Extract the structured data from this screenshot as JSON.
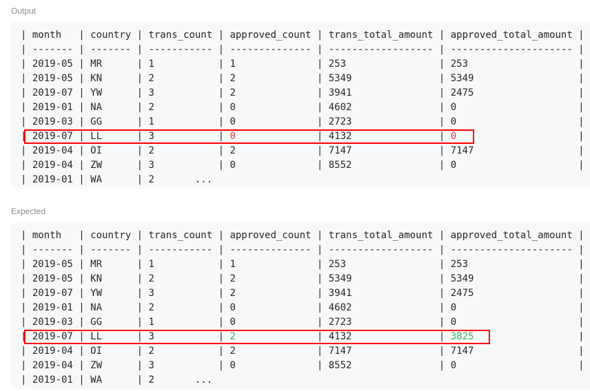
{
  "output": {
    "label": "Output",
    "header": [
      "month",
      "country",
      "trans_count",
      "approved_count",
      "trans_total_amount",
      "approved_total_amount"
    ],
    "separator": [
      "-------",
      "-------",
      "-----------",
      "--------------",
      "------------------",
      "---------------------"
    ],
    "rows": [
      [
        "2019-05",
        "MR",
        "1",
        "1",
        "253",
        "253"
      ],
      [
        "2019-05",
        "KN",
        "2",
        "2",
        "5349",
        "5349"
      ],
      [
        "2019-07",
        "YW",
        "3",
        "2",
        "3941",
        "2475"
      ],
      [
        "2019-01",
        "NA",
        "2",
        "0",
        "4602",
        "0"
      ],
      [
        "2019-03",
        "GG",
        "1",
        "0",
        "2723",
        "0"
      ],
      [
        "2019-07",
        "LL",
        "3",
        "0",
        "4132",
        "0"
      ],
      [
        "2019-04",
        "OI",
        "2",
        "2",
        "7147",
        "7147"
      ],
      [
        "2019-04",
        "ZW",
        "3",
        "0",
        "8552",
        "0"
      ]
    ],
    "last_row": [
      "2019-01",
      "WA",
      "2"
    ],
    "ellipsis": "...",
    "highlighted_row": 5,
    "highlight_color": "#ff0000",
    "diff_color": "#e04343"
  },
  "expected": {
    "label": "Expected",
    "header": [
      "month",
      "country",
      "trans_count",
      "approved_count",
      "trans_total_amount",
      "approved_total_amount"
    ],
    "separator": [
      "-------",
      "-------",
      "-----------",
      "--------------",
      "------------------",
      "---------------------"
    ],
    "rows": [
      [
        "2019-05",
        "MR",
        "1",
        "1",
        "253",
        "253"
      ],
      [
        "2019-05",
        "KN",
        "2",
        "2",
        "5349",
        "5349"
      ],
      [
        "2019-07",
        "YW",
        "3",
        "2",
        "3941",
        "2475"
      ],
      [
        "2019-01",
        "NA",
        "2",
        "0",
        "4602",
        "0"
      ],
      [
        "2019-03",
        "GG",
        "1",
        "0",
        "2723",
        "0"
      ],
      [
        "2019-07",
        "LL",
        "3",
        "2",
        "4132",
        "3825"
      ],
      [
        "2019-04",
        "OI",
        "2",
        "2",
        "7147",
        "7147"
      ],
      [
        "2019-04",
        "ZW",
        "3",
        "0",
        "8552",
        "0"
      ]
    ],
    "last_row": [
      "2019-01",
      "WA",
      "2"
    ],
    "ellipsis": "...",
    "highlighted_row": 5,
    "highlight_color": "#ff0000",
    "diff_color": "#3bb15b"
  }
}
